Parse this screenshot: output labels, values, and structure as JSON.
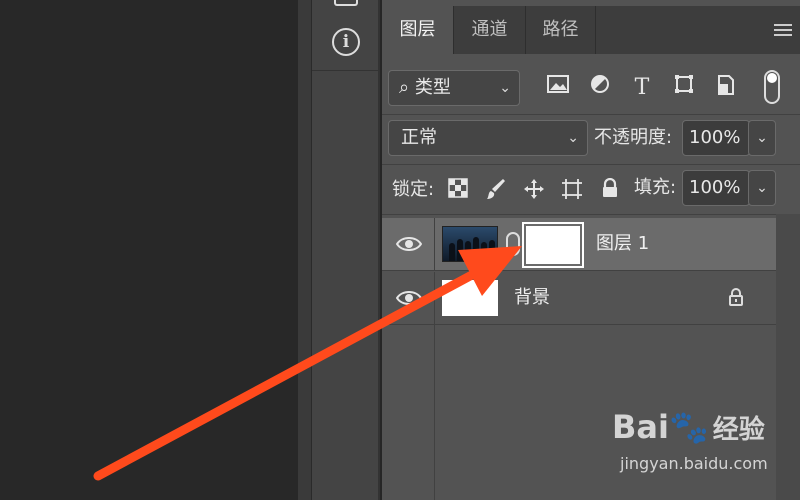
{
  "panel": {
    "tabs": [
      {
        "label": "图层",
        "active": true
      },
      {
        "label": "通道",
        "active": false
      },
      {
        "label": "路径",
        "active": false
      }
    ],
    "filter": {
      "label": "类型"
    },
    "blend_mode": "正常",
    "opacity_label": "不透明度:",
    "opacity_value": "100%",
    "lock_label": "锁定:",
    "fill_label": "填充:",
    "fill_value": "100%",
    "layers": [
      {
        "name": "图层 1",
        "selected": true,
        "has_mask": true
      },
      {
        "name": "背景",
        "selected": false,
        "locked": true
      }
    ]
  },
  "toolbar": {
    "info_symbol": "i"
  },
  "watermark": {
    "logo": "Bai",
    "logo_suffix": "经验",
    "url": "jingyan.baidu.com"
  },
  "colors": {
    "arrow": "#ff4a1c",
    "panel_bg": "#535353",
    "selected_row": "#6b6b6b"
  }
}
